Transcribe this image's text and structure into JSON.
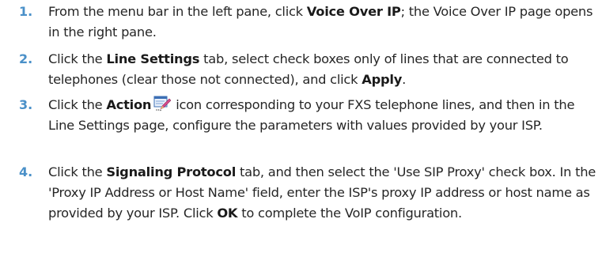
{
  "steps": [
    {
      "number": "1.",
      "t1": "From the menu bar in the left pane, click ",
      "b1": "Voice Over IP",
      "t2": "; the Voice Over IP page opens in the right pane."
    },
    {
      "number": "2.",
      "t1": "Click the ",
      "b1": "Line Settings",
      "t2": " tab, select check boxes only of lines that are connected to telephones (clear those not connected), and click ",
      "b2": "Apply",
      "t3": "."
    },
    {
      "number": "3.",
      "t1": "Click the ",
      "b1": "Action",
      "icon": "action-edit-icon",
      "t2": " icon corresponding to your FXS telephone lines, and then in the Line Settings page, configure the parameters with values provided by your ISP."
    },
    {
      "number": "4.",
      "t1": "Click the ",
      "b1": "Signaling Protocol",
      "t2": " tab, and then select the 'Use SIP Proxy' check box. In the 'Proxy IP Address or Host Name' field, enter the ISP's proxy IP address or host name as provided by your ISP. Click ",
      "b2": "OK",
      "t3": " to complete the VoIP configuration."
    }
  ],
  "colors": {
    "step_number": "#4a90c8",
    "body_text": "#262626"
  }
}
